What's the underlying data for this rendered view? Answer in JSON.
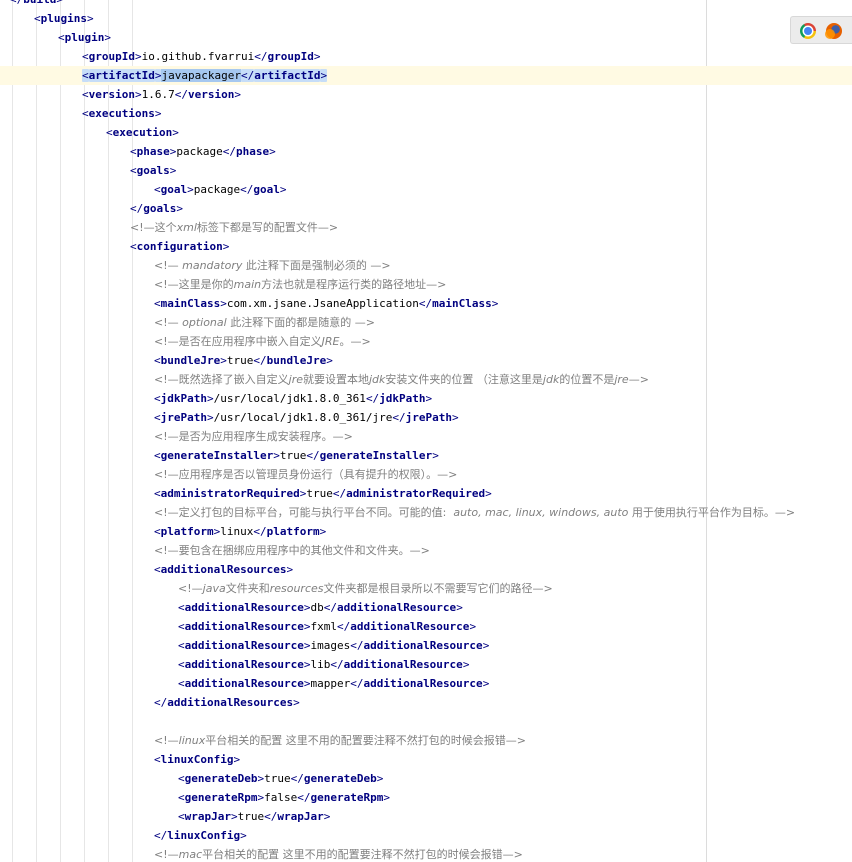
{
  "editor": {
    "lines": [
      {
        "indent": 0,
        "type": "close",
        "tag": "build",
        "cut": true
      },
      {
        "indent": 1,
        "type": "open",
        "tag": "plugins"
      },
      {
        "indent": 2,
        "type": "open",
        "tag": "plugin"
      },
      {
        "indent": 3,
        "type": "elem",
        "tag": "groupId",
        "text": "io.github.fvarrui"
      },
      {
        "indent": 3,
        "type": "elem",
        "tag": "artifactId",
        "text": "javapackager",
        "current": true
      },
      {
        "indent": 3,
        "type": "elem",
        "tag": "version",
        "text": "1.6.7"
      },
      {
        "indent": 3,
        "type": "open",
        "tag": "executions"
      },
      {
        "indent": 4,
        "type": "open",
        "tag": "execution"
      },
      {
        "indent": 5,
        "type": "elem",
        "tag": "phase",
        "text": "package"
      },
      {
        "indent": 5,
        "type": "open",
        "tag": "goals"
      },
      {
        "indent": 6,
        "type": "elem",
        "tag": "goal",
        "text": "package"
      },
      {
        "indent": 5,
        "type": "close",
        "tag": "goals"
      },
      {
        "indent": 5,
        "type": "comment",
        "parts": [
          [
            "n",
            "<!"
          ],
          [
            "n",
            "—这个"
          ],
          [
            "i",
            "xml"
          ],
          [
            "n",
            "标签下都是写的配置文件—"
          ],
          [
            "n",
            ">"
          ]
        ]
      },
      {
        "indent": 5,
        "type": "open",
        "tag": "configuration"
      },
      {
        "indent": 6,
        "type": "comment",
        "parts": [
          [
            "n",
            "<!— "
          ],
          [
            "i",
            "mandatory"
          ],
          [
            "n",
            " 此注释下面是强制必须的 —"
          ],
          [
            "n",
            ">"
          ]
        ]
      },
      {
        "indent": 6,
        "type": "comment",
        "parts": [
          [
            "n",
            "<!"
          ],
          [
            "n",
            "—这里是你的"
          ],
          [
            "i",
            "main"
          ],
          [
            "n",
            "方法也就是程序运行类的路径地址—"
          ],
          [
            "n",
            ">"
          ]
        ]
      },
      {
        "indent": 6,
        "type": "elem",
        "tag": "mainClass",
        "text": "com.xm.jsane.JsaneApplication"
      },
      {
        "indent": 6,
        "type": "comment",
        "parts": [
          [
            "n",
            "<!— "
          ],
          [
            "i",
            "optional"
          ],
          [
            "n",
            " 此注释下面的都是随意的 —"
          ],
          [
            "n",
            ">"
          ]
        ]
      },
      {
        "indent": 6,
        "type": "comment",
        "parts": [
          [
            "n",
            "<!"
          ],
          [
            "n",
            "—是否在应用程序中嵌入自定义"
          ],
          [
            "i",
            "JRE"
          ],
          [
            "n",
            "。—"
          ],
          [
            "n",
            ">"
          ]
        ]
      },
      {
        "indent": 6,
        "type": "elem",
        "tag": "bundleJre",
        "text": "true"
      },
      {
        "indent": 6,
        "type": "comment",
        "parts": [
          [
            "n",
            "<!"
          ],
          [
            "n",
            "—既然选择了嵌入自定义"
          ],
          [
            "i",
            "jre"
          ],
          [
            "n",
            "就要设置本地"
          ],
          [
            "i",
            "jdk"
          ],
          [
            "n",
            "安装文件夹的位置 （注意这里是"
          ],
          [
            "i",
            "jdk"
          ],
          [
            "n",
            "的位置不是"
          ],
          [
            "i",
            "jre"
          ],
          [
            "n",
            "—"
          ],
          [
            "n",
            ">"
          ]
        ]
      },
      {
        "indent": 6,
        "type": "elem",
        "tag": "jdkPath",
        "text": "/usr/local/jdk1.8.0_361"
      },
      {
        "indent": 6,
        "type": "elem",
        "tag": "jrePath",
        "text": "/usr/local/jdk1.8.0_361/jre"
      },
      {
        "indent": 6,
        "type": "comment",
        "parts": [
          [
            "n",
            "<!"
          ],
          [
            "n",
            "—是否为应用程序生成安装程序。—"
          ],
          [
            "n",
            ">"
          ]
        ]
      },
      {
        "indent": 6,
        "type": "elem",
        "tag": "generateInstaller",
        "text": "true"
      },
      {
        "indent": 6,
        "type": "comment",
        "parts": [
          [
            "n",
            "<!"
          ],
          [
            "n",
            "—应用程序是否以管理员身份运行（具有提升的权限）。—"
          ],
          [
            "n",
            ">"
          ]
        ]
      },
      {
        "indent": 6,
        "type": "elem",
        "tag": "administratorRequired",
        "text": "true"
      },
      {
        "indent": 6,
        "type": "comment",
        "parts": [
          [
            "n",
            "<!"
          ],
          [
            "n",
            "—定义打包的目标平台，可能与执行平台不同。可能的值:  "
          ],
          [
            "i",
            "auto, mac, linux, windows, auto"
          ],
          [
            "n",
            " 用于使用执行平台作为目标。—"
          ],
          [
            "n",
            ">"
          ]
        ]
      },
      {
        "indent": 6,
        "type": "elem",
        "tag": "platform",
        "text": "linux"
      },
      {
        "indent": 6,
        "type": "comment",
        "parts": [
          [
            "n",
            "<!"
          ],
          [
            "n",
            "—要包含在捆绑应用程序中的其他文件和文件夹。—"
          ],
          [
            "n",
            ">"
          ]
        ]
      },
      {
        "indent": 6,
        "type": "open",
        "tag": "additionalResources"
      },
      {
        "indent": 7,
        "type": "comment",
        "parts": [
          [
            "n",
            "<!"
          ],
          [
            "n",
            "—"
          ],
          [
            "i",
            "java"
          ],
          [
            "n",
            "文件夹和"
          ],
          [
            "i",
            "resources"
          ],
          [
            "n",
            "文件夹都是根目录所以不需要写它们的路径—"
          ],
          [
            "n",
            ">"
          ]
        ]
      },
      {
        "indent": 7,
        "type": "elem",
        "tag": "additionalResource",
        "text": "db"
      },
      {
        "indent": 7,
        "type": "elem",
        "tag": "additionalResource",
        "text": "fxml"
      },
      {
        "indent": 7,
        "type": "elem",
        "tag": "additionalResource",
        "text": "images"
      },
      {
        "indent": 7,
        "type": "elem",
        "tag": "additionalResource",
        "text": "lib"
      },
      {
        "indent": 7,
        "type": "elem",
        "tag": "additionalResource",
        "text": "mapper"
      },
      {
        "indent": 6,
        "type": "close",
        "tag": "additionalResources"
      },
      {
        "indent": 6,
        "type": "blank"
      },
      {
        "indent": 6,
        "type": "comment",
        "parts": [
          [
            "n",
            "<!"
          ],
          [
            "n",
            "—"
          ],
          [
            "i",
            "linux"
          ],
          [
            "n",
            "平台相关的配置 这里不用的配置要注释不然打包的时候会报错—"
          ],
          [
            "n",
            ">"
          ]
        ]
      },
      {
        "indent": 6,
        "type": "open",
        "tag": "linuxConfig"
      },
      {
        "indent": 7,
        "type": "elem",
        "tag": "generateDeb",
        "text": "true"
      },
      {
        "indent": 7,
        "type": "elem",
        "tag": "generateRpm",
        "text": "false"
      },
      {
        "indent": 7,
        "type": "elem",
        "tag": "wrapJar",
        "text": "true"
      },
      {
        "indent": 6,
        "type": "close",
        "tag": "linuxConfig"
      },
      {
        "indent": 6,
        "type": "comment",
        "parts": [
          [
            "n",
            "<!"
          ],
          [
            "n",
            "—"
          ],
          [
            "i",
            "mac"
          ],
          [
            "n",
            "平台相关的配置 这里不用的配置要注释不然打包的时候会报错—"
          ],
          [
            "n",
            ">"
          ]
        ]
      }
    ]
  },
  "browser_icons": [
    "chrome-icon",
    "firefox-icon"
  ]
}
